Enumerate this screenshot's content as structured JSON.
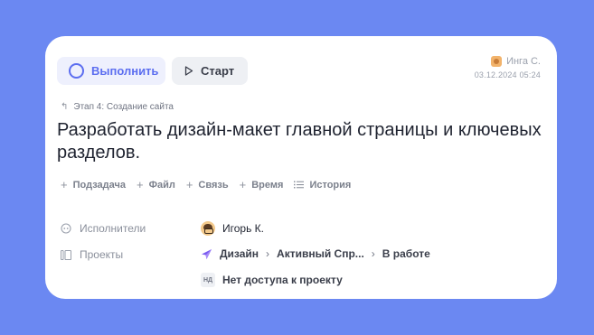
{
  "toolbar": {
    "complete_label": "Выполнить",
    "start_label": "Старт"
  },
  "author": {
    "name": "Инга С.",
    "timestamp": "03.12.2024 05:24"
  },
  "task": {
    "stage": "Этап 4: Создание сайта",
    "title": "Разработать дизайн-макет главной страницы и ключевых разделов."
  },
  "actions": [
    {
      "label": "Подзадача",
      "icon": "plus-icon"
    },
    {
      "label": "Файл",
      "icon": "plus-icon"
    },
    {
      "label": "Связь",
      "icon": "plus-icon"
    },
    {
      "label": "Время",
      "icon": "plus-icon"
    },
    {
      "label": "История",
      "icon": "list-icon"
    }
  ],
  "fields": {
    "assignees_label": "Исполнители",
    "projects_label": "Проекты",
    "assignee_name": "Игорь К.",
    "project_path": [
      "Дизайн",
      "Активный Спр...",
      "В работе"
    ],
    "no_access_badge": "НД",
    "no_access_text": "Нет доступа к проекту"
  },
  "colors": {
    "background": "#6b88f2",
    "accent": "#5c6ef0",
    "card": "#ffffff"
  }
}
